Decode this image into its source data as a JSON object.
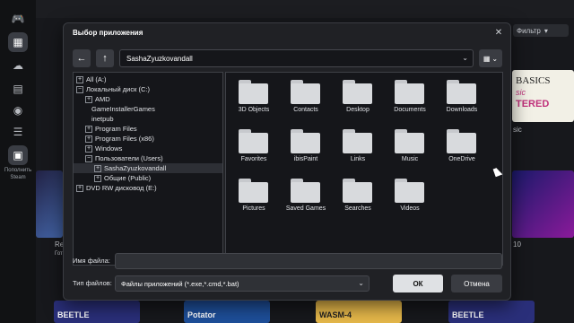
{
  "app": {
    "sidebar": {
      "add_label_line1": "Пополнить",
      "add_label_line2": "Steam"
    },
    "filter_label": "Фильтр",
    "cards": [
      {
        "title": "BASICS",
        "subtitle": "sic",
        "extra": "TERED"
      },
      {
        "title": "BEETLE"
      },
      {
        "title": "Potator"
      },
      {
        "title": "WASM-4"
      },
      {
        "title": "BEETLE"
      }
    ],
    "captions": {
      "left_partial": "Re",
      "left_partial2": "Гот",
      "right_partial": "sic",
      "right_partial2": "10"
    }
  },
  "dialog": {
    "title": "Выбор приложения",
    "path": "SashaZyuzkovandall",
    "tree": [
      {
        "label": "All (A:)",
        "expander": "+"
      },
      {
        "label": "Локальный диск (C:)",
        "expander": "−"
      },
      {
        "label": "AMD",
        "expander": "+"
      },
      {
        "label": "GameInstallerGames",
        "expander": ""
      },
      {
        "label": "inetpub",
        "expander": ""
      },
      {
        "label": "Program Files",
        "expander": "+"
      },
      {
        "label": "Program Files (x86)",
        "expander": "+"
      },
      {
        "label": "Windows",
        "expander": "+"
      },
      {
        "label": "Пользователи (Users)",
        "expander": "−"
      },
      {
        "label": "SashaZyuzkovandall",
        "expander": "+"
      },
      {
        "label": "Общие (Public)",
        "expander": "+"
      },
      {
        "label": "DVD RW дисковод (E:)",
        "expander": "+"
      }
    ],
    "folders": [
      "3D Objects",
      "Contacts",
      "Desktop",
      "Documents",
      "Downloads",
      "Favorites",
      "ibisPaint",
      "Links",
      "Music",
      "OneDrive",
      "Pictures",
      "Saved Games",
      "Searches",
      "Videos"
    ],
    "file_name_label": "Имя файла:",
    "file_name_value": "",
    "file_type_label": "Тип файлов:",
    "file_type_value": "Файлы приложений (*.exe,*.cmd,*.bat)",
    "ok_label": "ОК",
    "cancel_label": "Отмена"
  },
  "colors": {
    "background": "#17181c",
    "dialog": "#202125",
    "pane": "#15161a",
    "ok_button": "#dfe1e4",
    "button": "#3a3c42"
  }
}
